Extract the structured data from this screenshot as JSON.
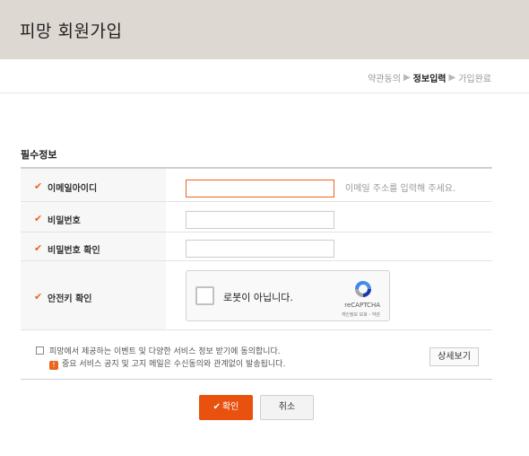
{
  "header": {
    "title": "피망 회원가입"
  },
  "steps": [
    {
      "label": "약관동의",
      "active": false
    },
    {
      "label": "정보입력",
      "active": true
    },
    {
      "label": "가입완료",
      "active": false
    }
  ],
  "section": {
    "title": "필수정보"
  },
  "form": {
    "email": {
      "label": "이메일아이디",
      "value": "",
      "hint": "이메일 주소를 입력해 주세요."
    },
    "password": {
      "label": "비밀번호",
      "value": ""
    },
    "password_confirm": {
      "label": "비밀번호 확인",
      "value": ""
    },
    "security": {
      "label": "안전키 확인"
    }
  },
  "captcha": {
    "label": "로봇이 아닙니다.",
    "brand": "reCAPTCHA",
    "terms": "개인정보 보호 - 약관"
  },
  "agree": {
    "line1": "피망에서 제공하는 이벤트 및 다양한 서비스 정보 받기에 동의합니다.",
    "badge": "!",
    "line2": "중요 서비스 공지 및 고지 메일은 수신동의와 관계없이 발송됩니다.",
    "detail_button": "상세보기",
    "checked": false
  },
  "buttons": {
    "confirm": "확인",
    "cancel": "취소"
  },
  "colors": {
    "accent": "#e8661e",
    "header_bg": "#ddd8d2"
  }
}
